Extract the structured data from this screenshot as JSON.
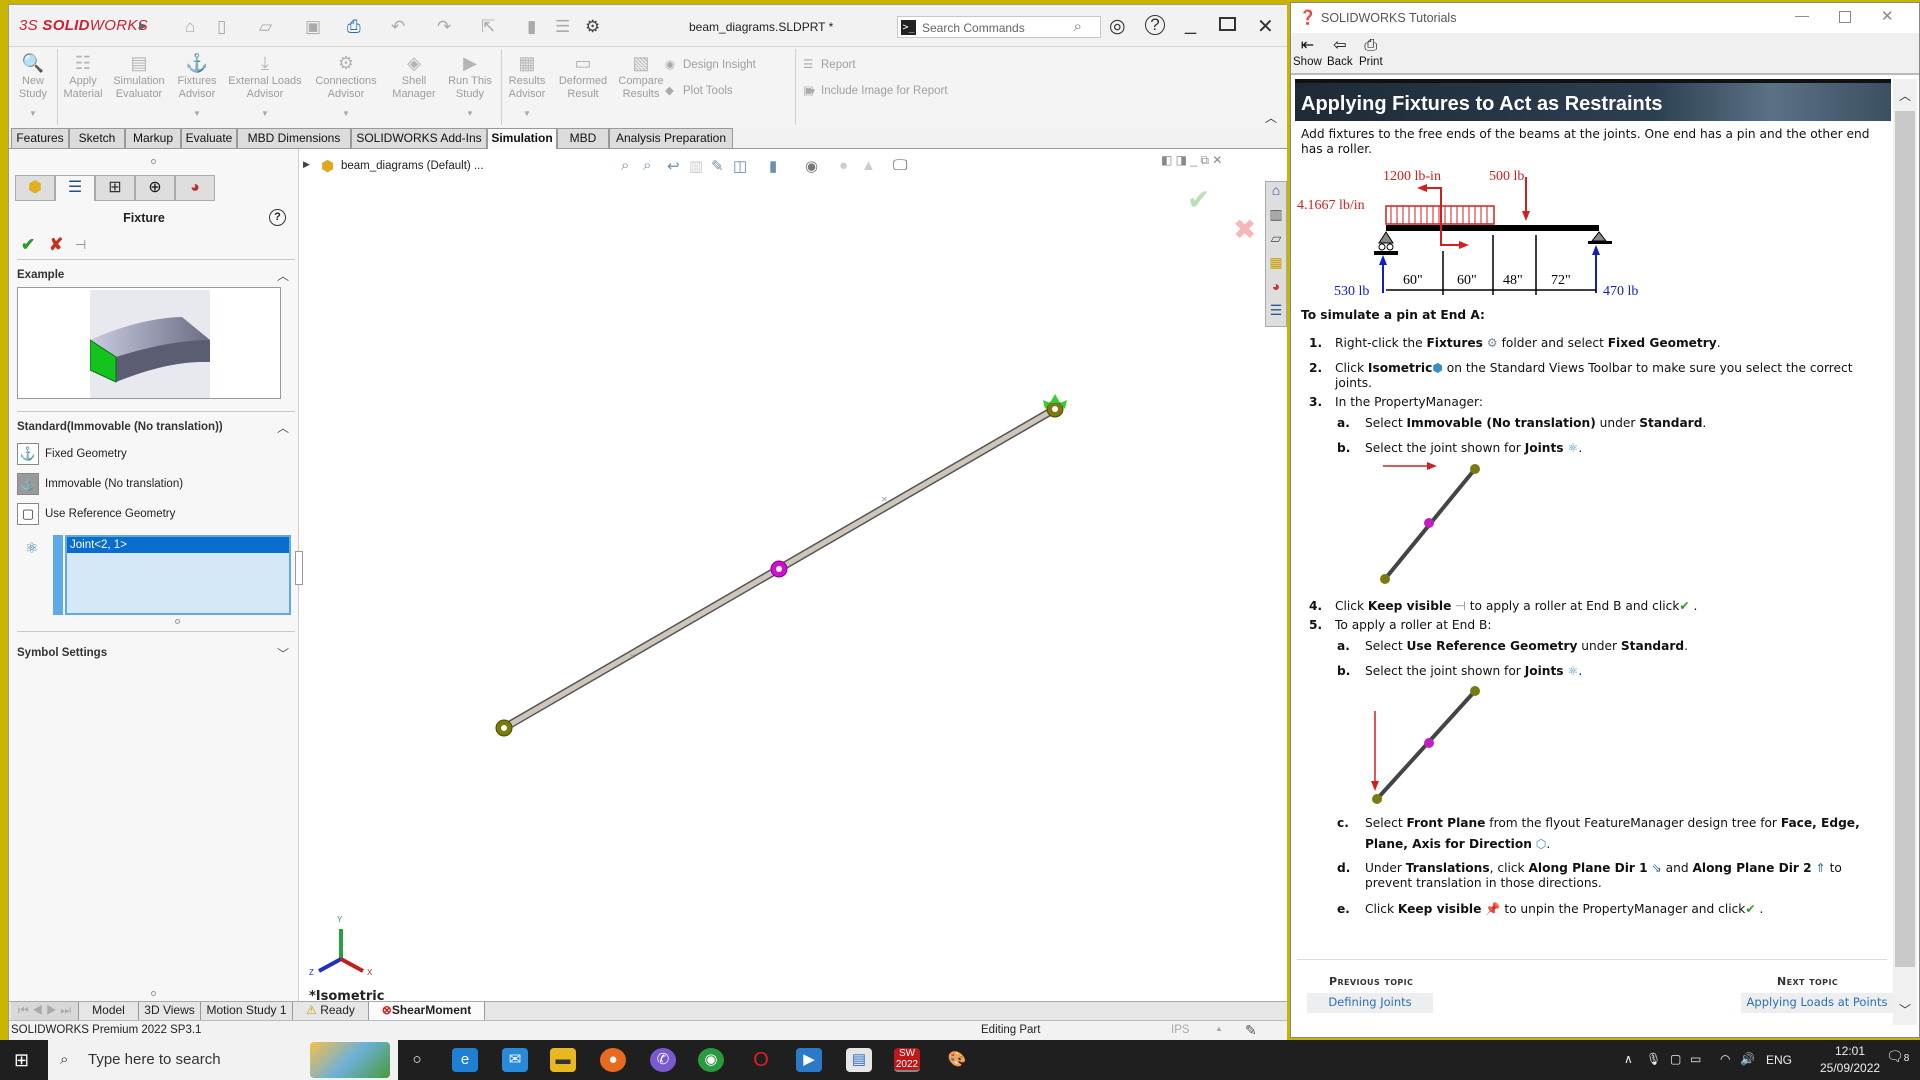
{
  "sw": {
    "logo_ds": "3S",
    "logo_solid": "SOLID",
    "logo_works": "WORKS",
    "doc_title": "beam_diagrams.SLDPRT *",
    "search_placeholder": "Search Commands",
    "command_buttons": [
      {
        "label1": "New",
        "label2": "Study",
        "icon": "new-study-icon"
      },
      {
        "label1": "Apply",
        "label2": "Material",
        "icon": "apply-material-icon"
      },
      {
        "label1": "Simulation",
        "label2": "Evaluator",
        "icon": "simulation-evaluator-icon"
      },
      {
        "label1": "Fixtures",
        "label2": "Advisor",
        "icon": "fixtures-advisor-icon"
      },
      {
        "label1": "External Loads",
        "label2": "Advisor",
        "icon": "external-loads-icon"
      },
      {
        "label1": "Connections",
        "label2": "Advisor",
        "icon": "connections-icon"
      },
      {
        "label1": "Shell",
        "label2": "Manager",
        "icon": "shell-manager-icon"
      },
      {
        "label1": "Run This",
        "label2": "Study",
        "icon": "run-study-icon"
      },
      {
        "label1": "Results",
        "label2": "Advisor",
        "icon": "results-advisor-icon"
      },
      {
        "label1": "Deformed",
        "label2": "Result",
        "icon": "deformed-result-icon"
      },
      {
        "label1": "Compare",
        "label2": "Results",
        "icon": "compare-results-icon"
      }
    ],
    "small_buttons": {
      "design_insight": "Design Insight",
      "plot_tools": "Plot Tools",
      "report": "Report",
      "include_image": "Include Image for Report"
    },
    "tabs": [
      "Features",
      "Sketch",
      "Markup",
      "Evaluate",
      "MBD Dimensions",
      "SOLIDWORKS Add-Ins",
      "Simulation",
      "MBD",
      "Analysis Preparation"
    ],
    "active_tab": "Simulation",
    "property_manager": {
      "title": "Fixture",
      "example_label": "Example",
      "standard_label": "Standard(Immovable (No translation))",
      "options": [
        "Fixed Geometry",
        "Immovable (No translation)",
        "Use Reference Geometry"
      ],
      "selected_option": "Immovable (No translation)",
      "selection_items": [
        "Joint<2, 1>"
      ],
      "symbol_settings": "Symbol Settings"
    },
    "tree_root": "beam_diagrams (Default) ...",
    "view_label": "*Isometric",
    "axis_labels": {
      "x": "X",
      "y": "Y",
      "z": "Z"
    },
    "bottom_tabs": [
      "Model",
      "3D Views",
      "Motion Study 1",
      "Ready",
      "ShearMoment"
    ],
    "status": {
      "product": "SOLIDWORKS Premium 2022 SP3.1",
      "mode": "Editing Part",
      "units": "IPS"
    }
  },
  "help": {
    "window_title": "SOLIDWORKS Tutorials",
    "toolbar": [
      "Show",
      "Back",
      "Print"
    ],
    "heading": "Applying Fixtures to Act as Restraints",
    "intro": "Add fixtures to the free ends of the beams at the joints. One end has a pin and the other end has a roller.",
    "diagram": {
      "moment": "1200  lb-in",
      "point_load": "500  lb",
      "distributed": "4.1667  lb/in",
      "reaction_left": "530 lb",
      "reaction_right": "470 lb",
      "spans": [
        "60\"",
        "60\"",
        "48\"",
        "72\""
      ]
    },
    "subheading": "To simulate a pin at End A:",
    "steps": {
      "s1": {
        "num": "1.",
        "pre": "Right-click the ",
        "b1": "Fixtures",
        "mid": " folder and select ",
        "b2": "Fixed Geometry",
        "post": "."
      },
      "s2": {
        "num": "2.",
        "pre": "Click ",
        "b1": "Isometric",
        "post": " on the Standard Views Toolbar to make sure you select the correct joints."
      },
      "s3": {
        "num": "3.",
        "text": "In the PropertyManager:"
      },
      "s3a": {
        "num": "a.",
        "pre": "Select ",
        "b1": "Immovable (No translation)",
        "mid": " under ",
        "b2": "Standard",
        "post": "."
      },
      "s3b": {
        "num": "b.",
        "pre": "Select the joint shown for ",
        "b1": "Joints",
        "post": "."
      },
      "s4": {
        "num": "4.",
        "pre": "Click ",
        "b1": "Keep visible",
        "mid": " to apply a roller at End B and click",
        "post": " ."
      },
      "s5": {
        "num": "5.",
        "text": "To apply a roller at End B:"
      },
      "s5a": {
        "num": "a.",
        "pre": "Select ",
        "b1": "Use Reference Geometry",
        "mid": " under ",
        "b2": "Standard",
        "post": "."
      },
      "s5b": {
        "num": "b.",
        "pre": "Select the joint shown for ",
        "b1": "Joints",
        "post": "."
      },
      "s5c": {
        "num": "c.",
        "pre": "Select ",
        "b1": "Front Plane",
        "mid": " from the flyout FeatureManager design tree for ",
        "b2": "Face, Edge, Plane, Axis for Direction",
        "post": "."
      },
      "s5d": {
        "num": "d.",
        "pre": "Under ",
        "b1": "Translations",
        "mid": ", click ",
        "b2": "Along Plane Dir 1",
        "mid2": " and ",
        "b3": "Along Plane Dir 2",
        "post": " to prevent translation in those directions."
      },
      "s5e": {
        "num": "e.",
        "pre": "Click ",
        "b1": "Keep visible",
        "mid": " to unpin the PropertyManager and click",
        "post": " ."
      }
    },
    "prev_label": "Previous topic",
    "prev_link": "Defining Joints",
    "next_label": "Next topic",
    "next_link": "Applying Loads at Points"
  },
  "taskbar": {
    "search_placeholder": "Type here to search",
    "language": "ENG",
    "time": "12:01",
    "date": "25/09/2022",
    "notifications": "8"
  }
}
